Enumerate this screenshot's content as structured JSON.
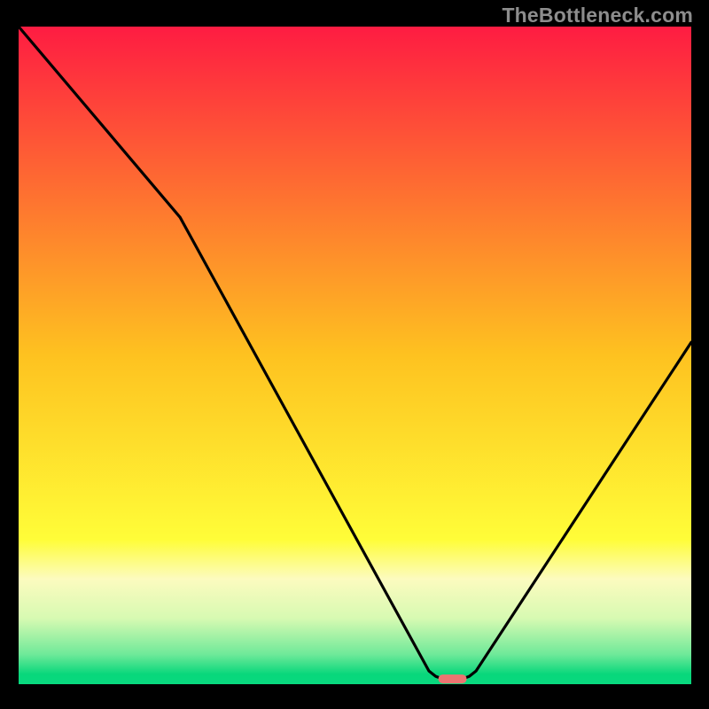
{
  "watermark": "TheBottleneck.com",
  "chart_data": {
    "type": "line",
    "title": "",
    "xlabel": "",
    "ylabel": "",
    "xlim": [
      0,
      100
    ],
    "ylim": [
      0,
      100
    ],
    "series": [
      {
        "name": "curve",
        "points": [
          {
            "x": 0,
            "y": 100
          },
          {
            "x": 24,
            "y": 71
          },
          {
            "x": 61,
            "y": 2
          },
          {
            "x": 62,
            "y": 1.2
          },
          {
            "x": 63,
            "y": 0.8
          },
          {
            "x": 66,
            "y": 0.8
          },
          {
            "x": 67,
            "y": 1.2
          },
          {
            "x": 68,
            "y": 2
          },
          {
            "x": 100,
            "y": 52
          }
        ]
      }
    ],
    "marker": {
      "x": 64.5,
      "y": 0.8,
      "color": "#ec7471"
    },
    "background_gradient": [
      {
        "pos": 0.0,
        "color": "#fe1c42"
      },
      {
        "pos": 0.5,
        "color": "#fec220"
      },
      {
        "pos": 0.78,
        "color": "#fffd38"
      },
      {
        "pos": 0.84,
        "color": "#fcfbbf"
      },
      {
        "pos": 0.9,
        "color": "#d7fab2"
      },
      {
        "pos": 0.955,
        "color": "#6ee999"
      },
      {
        "pos": 0.985,
        "color": "#08d77b"
      },
      {
        "pos": 1.0,
        "color": "#09d97f"
      }
    ]
  }
}
